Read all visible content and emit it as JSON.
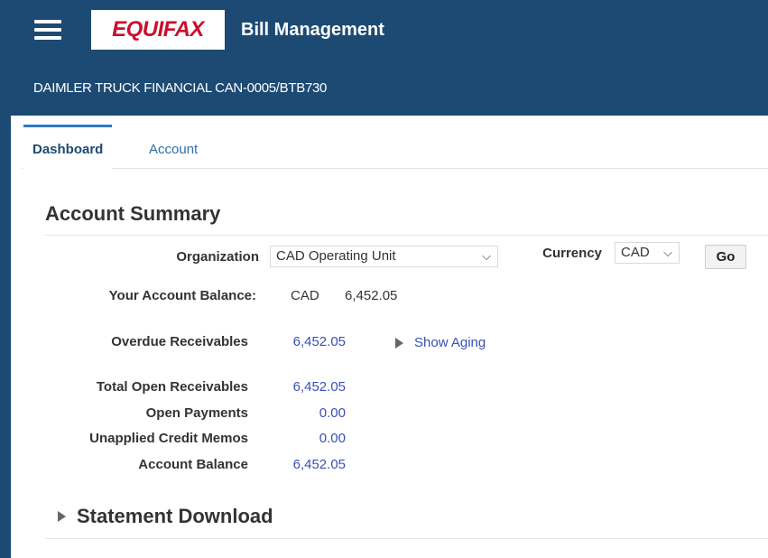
{
  "header": {
    "logo_text": "EQUIFAX",
    "app_title": "Bill Management",
    "account_name": "DAIMLER TRUCK FINANCIAL CAN-0005/BTB730",
    "bg_color": "#1d4a73"
  },
  "tabs": [
    {
      "label": "Dashboard",
      "active": true
    },
    {
      "label": "Account",
      "active": false
    }
  ],
  "summary": {
    "title": "Account Summary",
    "organization_label": "Organization",
    "organization_value": "CAD Operating Unit",
    "currency_label": "Currency",
    "currency_value": "CAD",
    "go_label": "Go",
    "balance_label": "Your Account Balance:",
    "balance_currency": "CAD",
    "balance_value": "6,452.05",
    "overdue_label": "Overdue Receivables",
    "overdue_value": "6,452.05",
    "show_aging_label": "Show Aging",
    "total_open_label": "Total Open Receivables",
    "total_open_value": "6,452.05",
    "open_payments_label": "Open Payments",
    "open_payments_value": "0.00",
    "unapplied_label": "Unapplied Credit Memos",
    "unapplied_value": "0.00",
    "account_balance_label": "Account Balance",
    "account_balance_value": "6,452.05"
  },
  "statement": {
    "title": "Statement Download"
  },
  "icons": {
    "menu": "hamburger-menu-icon",
    "dropdown": "chevron-down-icon",
    "expand": "triangle-right-icon"
  }
}
